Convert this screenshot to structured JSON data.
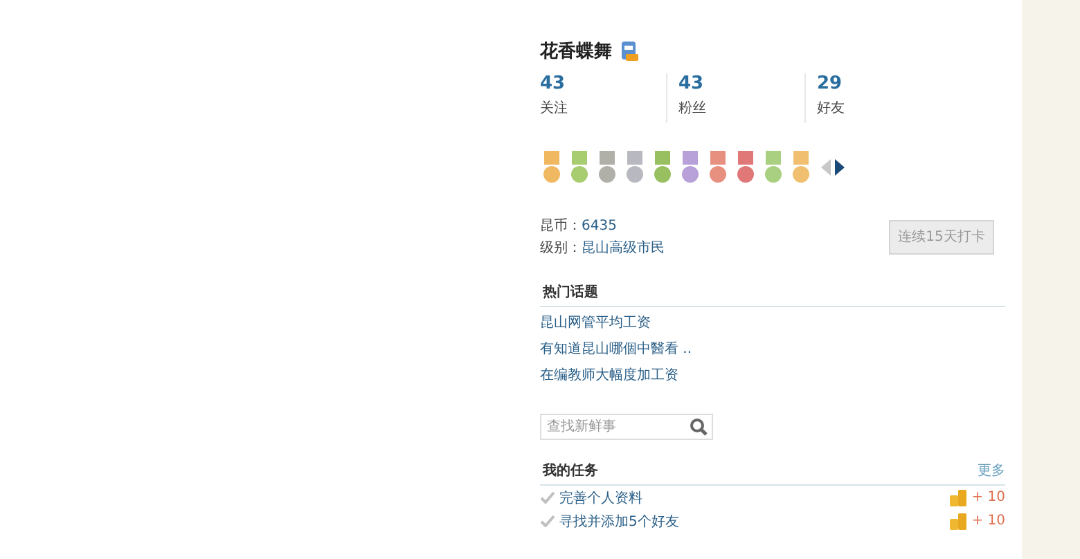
{
  "profile": {
    "name": "花香蝶舞"
  },
  "stats": [
    {
      "count": "43",
      "label": "关注"
    },
    {
      "count": "43",
      "label": "粉丝"
    },
    {
      "count": "29",
      "label": "好友"
    }
  ],
  "medals": [
    {
      "color": "#f0b860"
    },
    {
      "color": "#a8cc70"
    },
    {
      "color": "#b0b0a8"
    },
    {
      "color": "#b8b8c0"
    },
    {
      "color": "#98c060"
    },
    {
      "color": "#b8a0d8"
    },
    {
      "color": "#e89080"
    },
    {
      "color": "#e07878"
    },
    {
      "color": "#a8d080"
    },
    {
      "color": "#f0c070"
    }
  ],
  "coins": {
    "label": "昆币：",
    "value": "6435"
  },
  "level": {
    "label": "级别：",
    "value": "昆山高级市民"
  },
  "checkin_button": "连续15天打卡",
  "hot_topics": {
    "title": "热门话题",
    "items": [
      "昆山网管平均工资",
      "有知道昆山哪個中醫看 ..",
      "在编教师大幅度加工资"
    ]
  },
  "search": {
    "placeholder": "查找新鲜事"
  },
  "tasks": {
    "title": "我的任务",
    "more": "更多",
    "items": [
      {
        "label": "完善个人资料",
        "reward": "+ 10"
      },
      {
        "label": "寻找并添加5个好友",
        "reward": "+ 10"
      }
    ]
  }
}
